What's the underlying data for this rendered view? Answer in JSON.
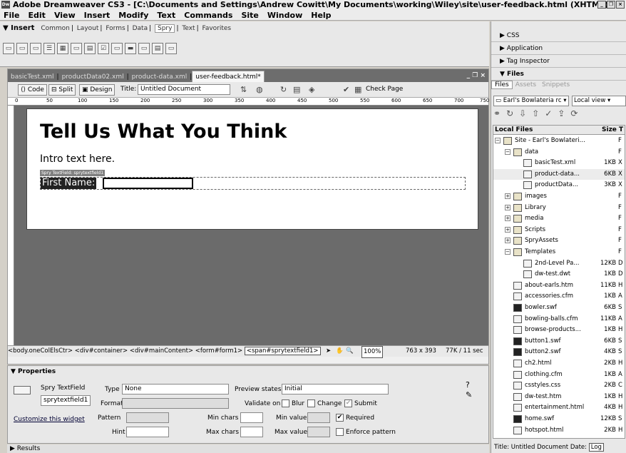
{
  "titlebar": {
    "app_icon": "Dw",
    "title": "Adobe Dreamweaver CS3 - [C:\\Documents and Settings\\Andrew Cowitt\\My Documents\\working\\Wiley\\site\\user-feedback.html (XHTML)*]"
  },
  "menu": [
    "File",
    "Edit",
    "View",
    "Insert",
    "Modify",
    "Text",
    "Commands",
    "Site",
    "Window",
    "Help"
  ],
  "insert_bar": {
    "label": "▼ Insert",
    "tabs": [
      "Common",
      "Layout",
      "Forms",
      "Data",
      "Spry",
      "Text",
      "Favorites"
    ],
    "active_tab": "Spry"
  },
  "doc_tabs": [
    "basicTest.xml",
    "productData02.xml",
    "product-data.xml",
    "user-feedback.html*"
  ],
  "doc_toolbar": {
    "code": "Code",
    "split": "Split",
    "design": "Design",
    "title_label": "Title:",
    "title_value": "Untitled Document",
    "check_page": "Check Page"
  },
  "ruler_ticks": [
    "0",
    "50",
    "100",
    "150",
    "200",
    "250",
    "300",
    "350",
    "400",
    "450",
    "500",
    "550",
    "600",
    "650",
    "700",
    "750"
  ],
  "page": {
    "heading": "Tell Us What You Think",
    "intro": "Intro text here.",
    "spry_label": "Spry TextField: sprytextfield1",
    "field_label": "First Name:"
  },
  "status": {
    "tags": "<body.oneColElsCtr> <div#container> <div#mainContent> <form#form1>",
    "selected_tag": "<span#sprytextfield1>",
    "zoom": "100%",
    "size": "763 x 393",
    "weight": "77K / 11 sec"
  },
  "properties": {
    "header": "▼ Properties",
    "widget_type": "Spry TextField",
    "widget_id": "sprytextfield1",
    "customize": "Customize this widget",
    "type_label": "Type",
    "type_value": "None",
    "format_label": "Format",
    "pattern_label": "Pattern",
    "hint_label": "Hint",
    "preview_label": "Preview states",
    "preview_value": "Initial",
    "validate_label": "Validate on",
    "blur": "Blur",
    "change": "Change",
    "submit": "Submit",
    "min_chars": "Min chars",
    "max_chars": "Max chars",
    "min_value": "Min value",
    "max_value": "Max value",
    "required": "Required",
    "enforce": "Enforce pattern"
  },
  "results": "▶ Results",
  "right_panels": {
    "css": "▶ CSS",
    "application": "▶ Application",
    "tag_inspector": "▶ Tag Inspector",
    "files": "▼ Files"
  },
  "files": {
    "tabs": [
      "Files",
      "Assets",
      "Snippets"
    ],
    "site": "Earl's Bowlateria rc",
    "view": "Local view",
    "col_name": "Local Files",
    "col_size": "Size",
    "col_type": "T",
    "rows": [
      {
        "name": "Site - Earl's Bowlateri...",
        "size": "",
        "type": "F",
        "kind": "folder",
        "indent": 1,
        "exp": "−"
      },
      {
        "name": "data",
        "size": "",
        "type": "F",
        "kind": "folder",
        "indent": 2,
        "exp": "−"
      },
      {
        "name": "basicTest.xml",
        "size": "1KB",
        "type": "X",
        "kind": "file",
        "indent": 3,
        "exp": ""
      },
      {
        "name": "product-data...",
        "size": "6KB",
        "type": "X",
        "kind": "file",
        "indent": 3,
        "exp": "",
        "hl": true
      },
      {
        "name": "productData...",
        "size": "3KB",
        "type": "X",
        "kind": "file",
        "indent": 3,
        "exp": ""
      },
      {
        "name": "images",
        "size": "",
        "type": "F",
        "kind": "folder",
        "indent": 2,
        "exp": "+"
      },
      {
        "name": "Library",
        "size": "",
        "type": "F",
        "kind": "folder",
        "indent": 2,
        "exp": "+"
      },
      {
        "name": "media",
        "size": "",
        "type": "F",
        "kind": "folder",
        "indent": 2,
        "exp": "+"
      },
      {
        "name": "Scripts",
        "size": "",
        "type": "F",
        "kind": "folder",
        "indent": 2,
        "exp": "+"
      },
      {
        "name": "SpryAssets",
        "size": "",
        "type": "F",
        "kind": "folder",
        "indent": 2,
        "exp": "+"
      },
      {
        "name": "Templates",
        "size": "",
        "type": "F",
        "kind": "folder",
        "indent": 2,
        "exp": "−"
      },
      {
        "name": "2nd-Level Pa...",
        "size": "12KB",
        "type": "D",
        "kind": "file",
        "indent": 3,
        "exp": ""
      },
      {
        "name": "dw-test.dwt",
        "size": "1KB",
        "type": "D",
        "kind": "file",
        "indent": 3,
        "exp": ""
      },
      {
        "name": "about-earls.htm",
        "size": "11KB",
        "type": "H",
        "kind": "file",
        "indent": 2,
        "exp": ""
      },
      {
        "name": "accessories.cfm",
        "size": "1KB",
        "type": "A",
        "kind": "file",
        "indent": 2,
        "exp": ""
      },
      {
        "name": "bowler.swf",
        "size": "6KB",
        "type": "S",
        "kind": "swf",
        "indent": 2,
        "exp": ""
      },
      {
        "name": "bowling-balls.cfm",
        "size": "11KB",
        "type": "A",
        "kind": "file",
        "indent": 2,
        "exp": ""
      },
      {
        "name": "browse-products...",
        "size": "1KB",
        "type": "H",
        "kind": "file",
        "indent": 2,
        "exp": ""
      },
      {
        "name": "button1.swf",
        "size": "6KB",
        "type": "S",
        "kind": "swf",
        "indent": 2,
        "exp": ""
      },
      {
        "name": "button2.swf",
        "size": "4KB",
        "type": "S",
        "kind": "swf",
        "indent": 2,
        "exp": ""
      },
      {
        "name": "ch2.html",
        "size": "2KB",
        "type": "H",
        "kind": "file",
        "indent": 2,
        "exp": ""
      },
      {
        "name": "clothing.cfm",
        "size": "1KB",
        "type": "A",
        "kind": "file",
        "indent": 2,
        "exp": ""
      },
      {
        "name": "csstyles.css",
        "size": "2KB",
        "type": "C",
        "kind": "file",
        "indent": 2,
        "exp": ""
      },
      {
        "name": "dw-test.htm",
        "size": "1KB",
        "type": "H",
        "kind": "file",
        "indent": 2,
        "exp": ""
      },
      {
        "name": "entertainment.html",
        "size": "4KB",
        "type": "H",
        "kind": "file",
        "indent": 2,
        "exp": ""
      },
      {
        "name": "home.swf",
        "size": "12KB",
        "type": "S",
        "kind": "swf",
        "indent": 2,
        "exp": ""
      },
      {
        "name": "hotspot.html",
        "size": "2KB",
        "type": "H",
        "kind": "file",
        "indent": 2,
        "exp": ""
      }
    ],
    "status": "Title: Untitled Document  Date:",
    "log": "Log"
  }
}
